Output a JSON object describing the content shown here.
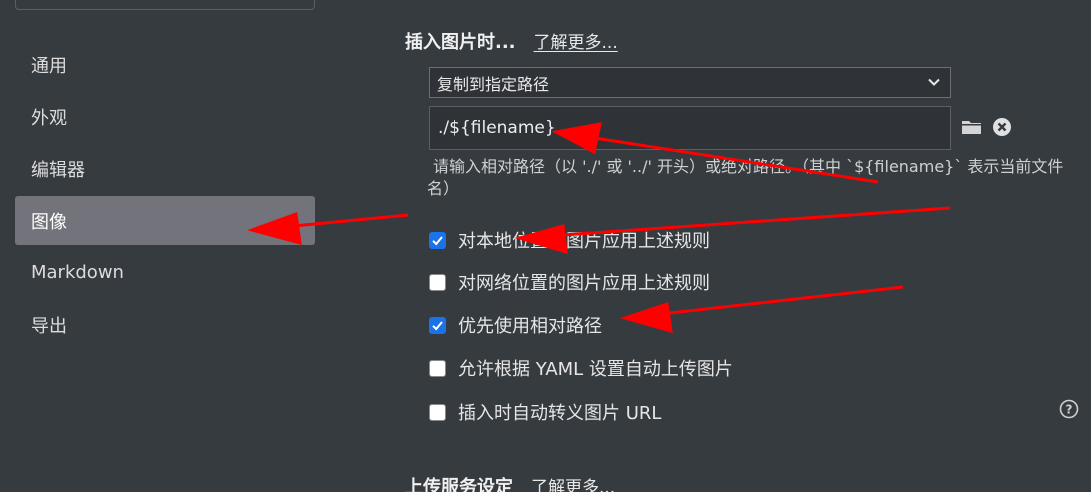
{
  "sidebar": {
    "items": [
      {
        "label": "通用",
        "active": false
      },
      {
        "label": "外观",
        "active": false
      },
      {
        "label": "编辑器",
        "active": false
      },
      {
        "label": "图像",
        "active": true
      },
      {
        "label": "Markdown",
        "active": false
      },
      {
        "label": "导出",
        "active": false
      }
    ]
  },
  "insert_section": {
    "title": "插入图片时...",
    "learn_more": "了解更多...",
    "action_select": {
      "value": "复制到指定路径"
    },
    "path_input": {
      "value": "./${filename}"
    },
    "hint": "请输入相对路径（以 './' 或 '../' 开头）或绝对路径。（其中 `${filename}` 表示当前文件名）",
    "options": [
      {
        "label": "对本地位置的图片应用上述规则",
        "checked": true
      },
      {
        "label": "对网络位置的图片应用上述规则",
        "checked": false
      },
      {
        "label": "优先使用相对路径",
        "checked": true
      },
      {
        "label": "允许根据 YAML 设置自动上传图片",
        "checked": false
      },
      {
        "label": "插入时自动转义图片 URL",
        "checked": false
      }
    ]
  },
  "upload_section": {
    "title": "上传服务设定",
    "learn_more": "了解更多..."
  },
  "icons": [
    "chevron-down-icon",
    "folder-icon",
    "clear-icon",
    "help-icon",
    "checkmark-icon"
  ],
  "colors": {
    "background": "#363b40",
    "active_item": "#73737b",
    "checkbox_checked": "#1a73e8",
    "annotation_arrow": "#ff0000"
  }
}
